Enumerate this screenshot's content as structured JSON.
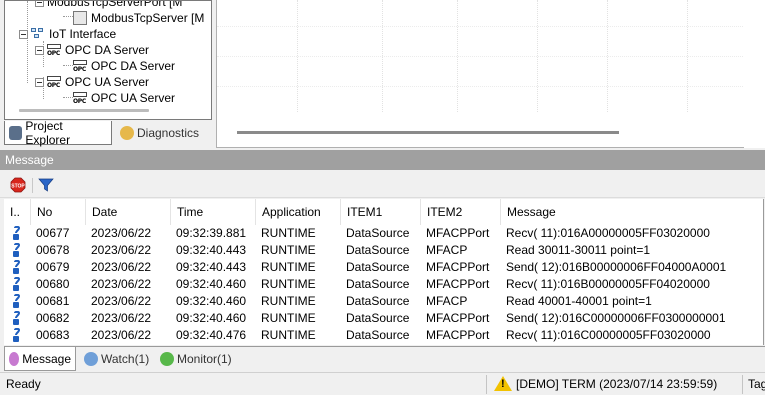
{
  "tree": {
    "items": [
      {
        "label": "ModbusTcpServerPort [M"
      },
      {
        "label": "ModbusTcpServer [M"
      },
      {
        "label": "IoT Interface"
      },
      {
        "label": "OPC DA Server"
      },
      {
        "label": "OPC DA Server"
      },
      {
        "label": "OPC UA Server"
      },
      {
        "label": "OPC UA Server"
      }
    ],
    "opc_icon_text": "OPC"
  },
  "left_tabs": {
    "project_explorer": "Project Explorer",
    "diagnostics": "Diagnostics"
  },
  "message_panel": {
    "title": "Message",
    "columns": [
      "I..",
      "No",
      "Date",
      "Time",
      "Application",
      "ITEM1",
      "ITEM2",
      "Message"
    ],
    "rows": [
      {
        "no": "00677",
        "date": "2023/06/22",
        "time": "09:32:39.881",
        "app": "RUNTIME",
        "item1": "DataSource",
        "item2": "MFACPPort",
        "msg": "Recv(  11):016A00000005FF03020000"
      },
      {
        "no": "00678",
        "date": "2023/06/22",
        "time": "09:32:40.443",
        "app": "RUNTIME",
        "item1": "DataSource",
        "item2": "MFACP",
        "msg": "Read 30011-30011 point=1"
      },
      {
        "no": "00679",
        "date": "2023/06/22",
        "time": "09:32:40.443",
        "app": "RUNTIME",
        "item1": "DataSource",
        "item2": "MFACPPort",
        "msg": "Send(  12):016B00000006FF04000A0001"
      },
      {
        "no": "00680",
        "date": "2023/06/22",
        "time": "09:32:40.460",
        "app": "RUNTIME",
        "item1": "DataSource",
        "item2": "MFACPPort",
        "msg": "Recv(  11):016B00000005FF04020000"
      },
      {
        "no": "00681",
        "date": "2023/06/22",
        "time": "09:32:40.460",
        "app": "RUNTIME",
        "item1": "DataSource",
        "item2": "MFACP",
        "msg": "Read 40001-40001 point=1"
      },
      {
        "no": "00682",
        "date": "2023/06/22",
        "time": "09:32:40.460",
        "app": "RUNTIME",
        "item1": "DataSource",
        "item2": "MFACPPort",
        "msg": "Send(  12):016C00000006FF0300000001"
      },
      {
        "no": "00683",
        "date": "2023/06/22",
        "time": "09:32:40.476",
        "app": "RUNTIME",
        "item1": "DataSource",
        "item2": "MFACPPort",
        "msg": "Recv(  11):016C00000005FF03020000"
      }
    ]
  },
  "bottom_tabs": {
    "message": "Message",
    "watch": "Watch(1)",
    "monitor": "Monitor(1)"
  },
  "status": {
    "ready": "Ready",
    "demo": "[DEMO] TERM (2023/07/14 23:59:59)",
    "tag": "Tag"
  },
  "colors": {
    "row_icon": "#1f5fbf",
    "stop": "#d8261c",
    "filter": "#2a66c8",
    "warning": "#f2c200"
  }
}
